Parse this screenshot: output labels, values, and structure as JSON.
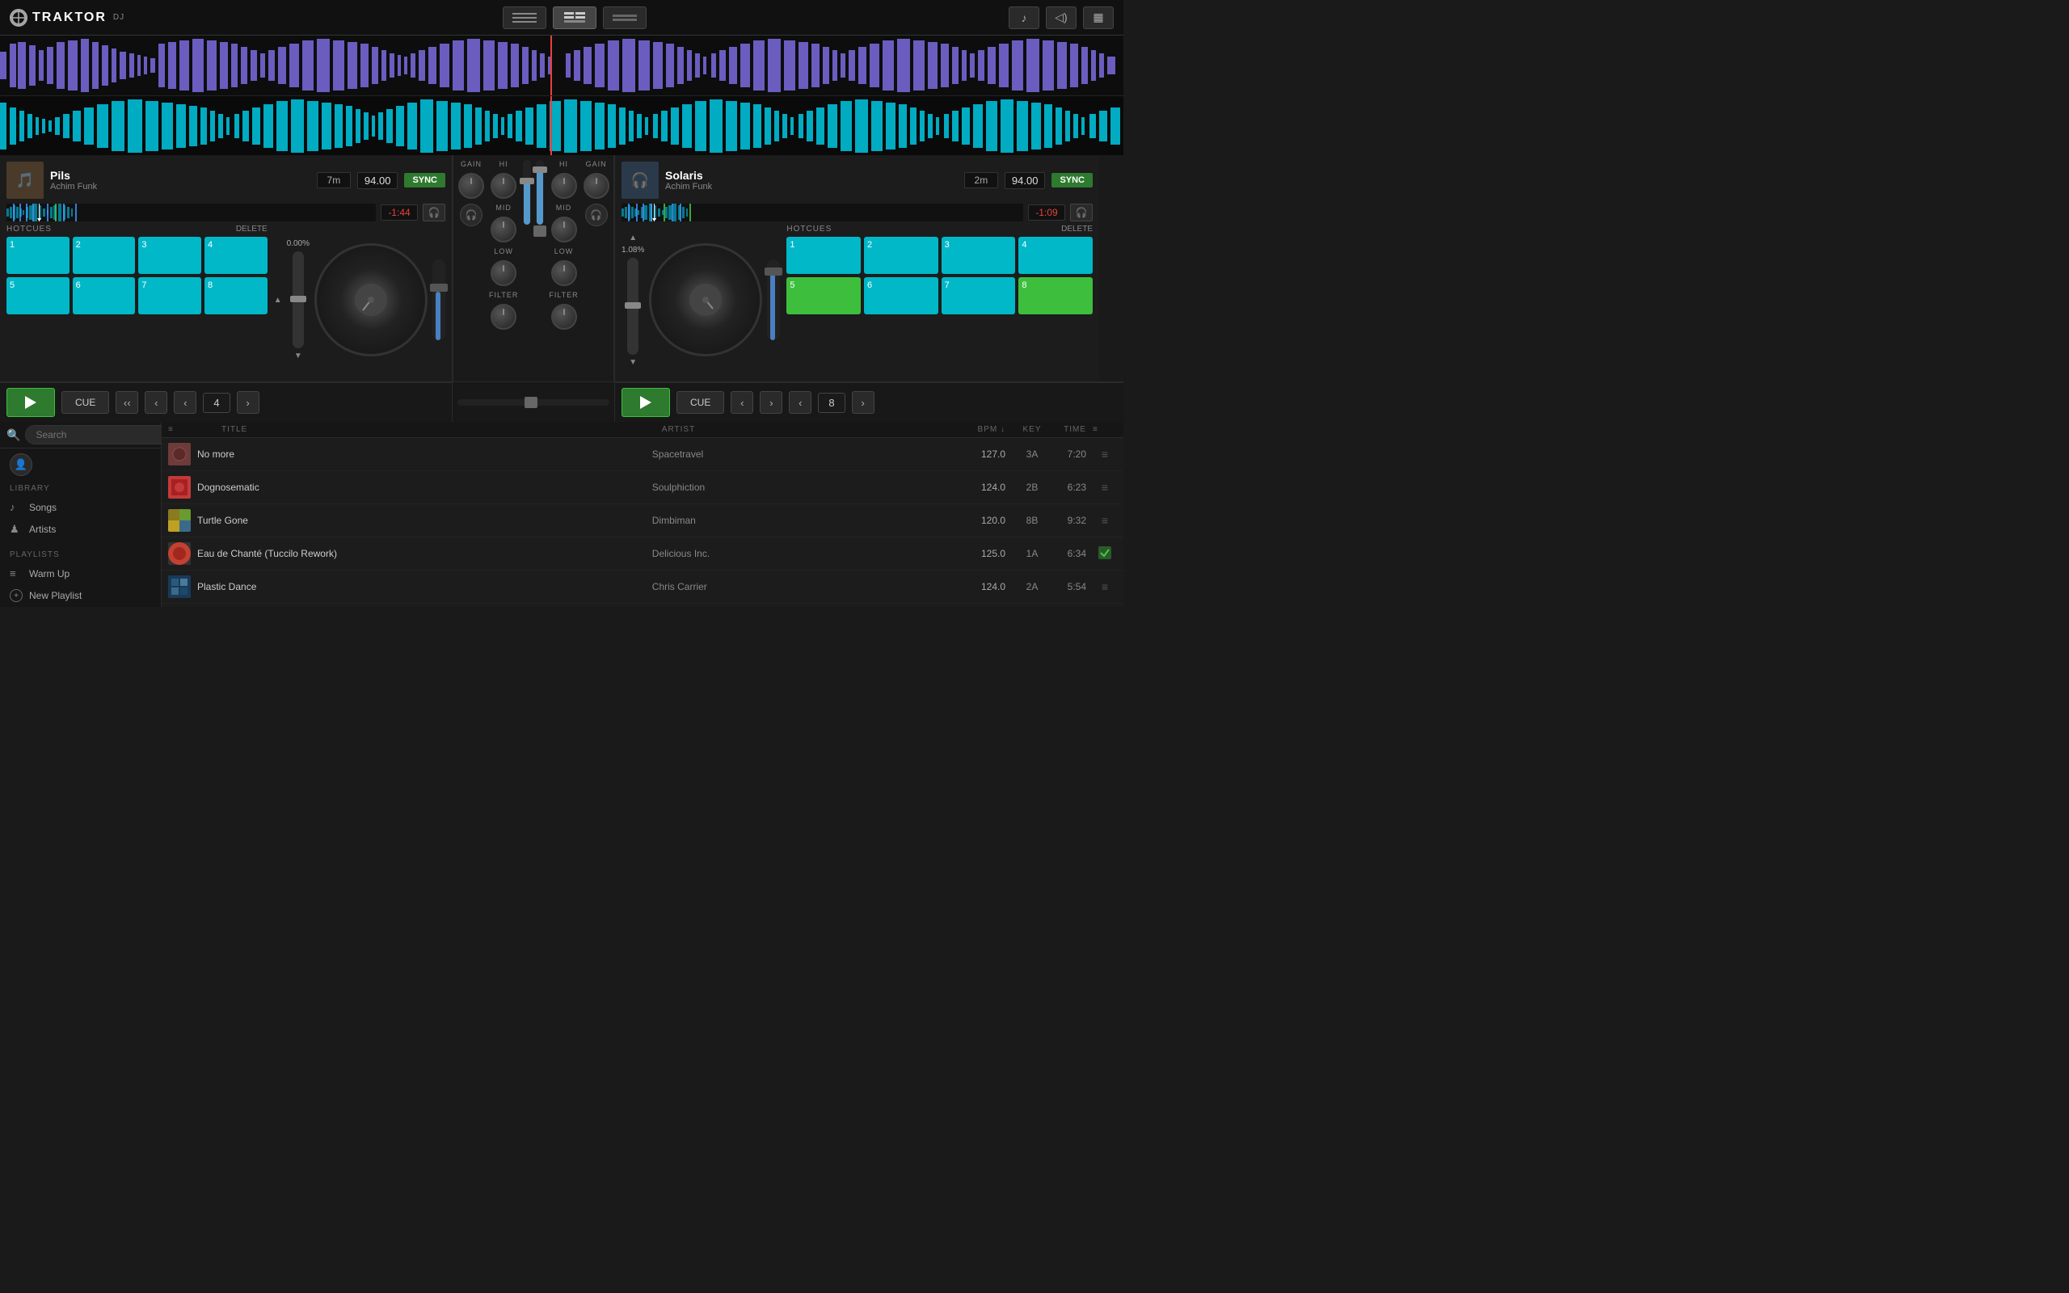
{
  "app": {
    "name": "TRAKTOR",
    "sub": "DJ",
    "logo_symbol": "○"
  },
  "layouts": [
    {
      "id": "layout1",
      "active": false
    },
    {
      "id": "layout2",
      "active": true
    },
    {
      "id": "layout3",
      "active": false
    }
  ],
  "top_right_icons": [
    "♪",
    "◁)",
    "▦"
  ],
  "deck_left": {
    "title": "Pils",
    "artist": "Achim Funk",
    "time_total": "7m",
    "bpm": "94.00",
    "sync_label": "SYNC",
    "elapsed": "-1:44",
    "pitch_pct": "0.00%",
    "hotcues_label": "HOTCUES",
    "delete_label": "DELETE",
    "hotcues": [
      {
        "num": "1"
      },
      {
        "num": "2"
      },
      {
        "num": "3"
      },
      {
        "num": "4"
      },
      {
        "num": "5"
      },
      {
        "num": "6"
      },
      {
        "num": "7"
      },
      {
        "num": "8"
      }
    ],
    "play_label": "",
    "cue_label": "CUE",
    "loop_num": "4",
    "art_emoji": "🎵"
  },
  "deck_right": {
    "title": "Solaris",
    "artist": "Achim Funk",
    "time_total": "2m",
    "bpm": "94.00",
    "sync_label": "SYNC",
    "elapsed": "-1:09",
    "pitch_pct": "1.08%",
    "hotcues_label": "HOTCUES",
    "delete_label": "DELETE",
    "hotcues": [
      {
        "num": "1"
      },
      {
        "num": "2"
      },
      {
        "num": "3"
      },
      {
        "num": "4"
      },
      {
        "num": "5",
        "green": true
      },
      {
        "num": "6"
      },
      {
        "num": "7"
      },
      {
        "num": "8",
        "green": true
      }
    ],
    "play_label": "",
    "cue_label": "CUE",
    "loop_num": "8",
    "art_emoji": "🎧"
  },
  "mixer": {
    "gain_label": "GAIN",
    "hi_label": "HI",
    "mid_label": "MID",
    "low_label": "LOW",
    "filter_label": "FILTER"
  },
  "library": {
    "search_placeholder": "Search",
    "section_label": "LIBRARY",
    "playlists_label": "PLAYLISTS",
    "nav_items": [
      {
        "icon": "♪",
        "label": "Songs"
      },
      {
        "icon": "♟",
        "label": "Artists"
      }
    ],
    "playlists": [
      {
        "icon": "≡",
        "label": "Warm Up"
      },
      {
        "icon": "+",
        "label": "New Playlist",
        "circle": true
      }
    ],
    "columns": {
      "title": "TITLE",
      "artist": "ARTIST",
      "bpm": "BPM ↓",
      "key": "KEY",
      "time": "TIME"
    },
    "tracks": [
      {
        "title": "No more",
        "artist": "Spacetravel",
        "bpm": "127.0",
        "key": "3A",
        "time": "7:20",
        "color": "#6e3a3a"
      },
      {
        "title": "Dognosematic",
        "artist": "Soulphiction",
        "bpm": "124.0",
        "key": "2B",
        "time": "6:23",
        "color": "#c43a3a"
      },
      {
        "title": "Turtle Gone",
        "artist": "Dimbiman",
        "bpm": "120.0",
        "key": "8B",
        "time": "9:32",
        "color": "#8a7a20"
      },
      {
        "title": "Eau de Chanté (Tuccilo Rework)",
        "artist": "Delicious Inc.",
        "bpm": "125.0",
        "key": "1A",
        "time": "6:34",
        "color": "#3a3a3a",
        "checked": true
      },
      {
        "title": "Plastic Dance",
        "artist": "Chris Carrier",
        "bpm": "124.0",
        "key": "2A",
        "time": "5:54",
        "color": "#1a3a5a"
      }
    ]
  }
}
